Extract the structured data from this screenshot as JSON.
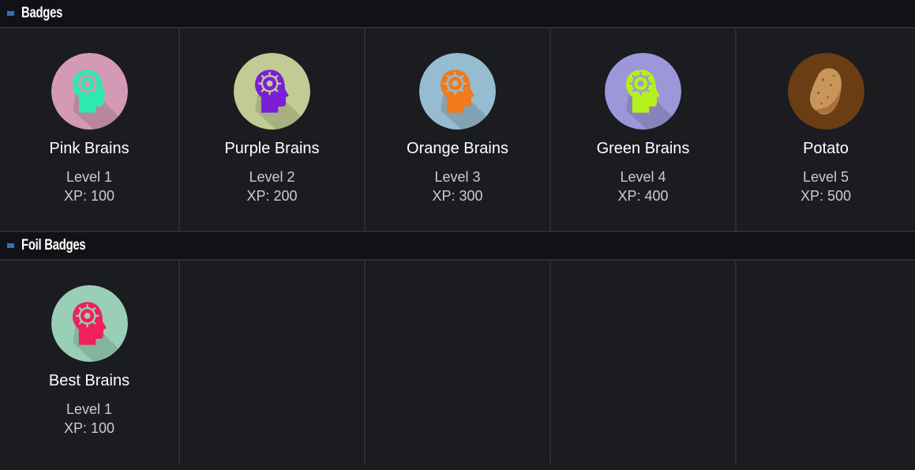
{
  "badges_section": {
    "title": "Badges",
    "items": [
      {
        "name": "Pink Brains",
        "level": "Level 1",
        "xp": "XP: 100",
        "icon": "brain-head-icon",
        "bg": "#d49ab5",
        "fg": "#2ee8b0"
      },
      {
        "name": "Purple Brains",
        "level": "Level 2",
        "xp": "XP: 200",
        "icon": "brain-head-icon",
        "bg": "#c0cc94",
        "fg": "#7a1fd6"
      },
      {
        "name": "Orange Brains",
        "level": "Level 3",
        "xp": "XP: 300",
        "icon": "brain-head-icon",
        "bg": "#96bcd2",
        "fg": "#f07a1c"
      },
      {
        "name": "Green Brains",
        "level": "Level 4",
        "xp": "XP: 400",
        "icon": "brain-head-icon",
        "bg": "#9d96d8",
        "fg": "#b4f01c"
      },
      {
        "name": "Potato",
        "level": "Level 5",
        "xp": "XP: 500",
        "icon": "potato-icon",
        "bg": "#6b3d14",
        "fg": "#c8955a"
      }
    ]
  },
  "foil_section": {
    "title": "Foil Badges",
    "items": [
      {
        "name": "Best Brains",
        "level": "Level 1",
        "xp": "XP: 100",
        "icon": "brain-head-icon",
        "bg": "#98cfb6",
        "fg": "#f0205a"
      }
    ]
  }
}
